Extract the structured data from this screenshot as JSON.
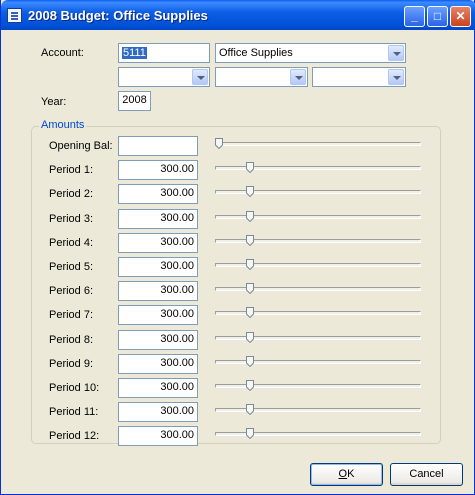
{
  "window": {
    "title": "2008 Budget: Office Supplies",
    "controls": {
      "minimize": "_",
      "maximize": "□",
      "close": "✕"
    }
  },
  "form": {
    "account_label": "Account:",
    "account_code": "5111",
    "account_name": "Office Supplies",
    "segment_1": "",
    "segment_2": "",
    "segment_3": "",
    "year_label": "Year:",
    "year_value": "2008"
  },
  "amounts": {
    "group_title": "Amounts",
    "slider_range": [
      0,
      2000
    ],
    "rows": [
      {
        "label": "Opening Bal:",
        "value": "",
        "slider_value": 0
      },
      {
        "label": "Period 1:",
        "value": "300.00",
        "slider_value": 300
      },
      {
        "label": "Period 2:",
        "value": "300.00",
        "slider_value": 300
      },
      {
        "label": "Period 3:",
        "value": "300.00",
        "slider_value": 300
      },
      {
        "label": "Period 4:",
        "value": "300.00",
        "slider_value": 300
      },
      {
        "label": "Period 5:",
        "value": "300.00",
        "slider_value": 300
      },
      {
        "label": "Period 6:",
        "value": "300.00",
        "slider_value": 300
      },
      {
        "label": "Period 7:",
        "value": "300.00",
        "slider_value": 300
      },
      {
        "label": "Period 8:",
        "value": "300.00",
        "slider_value": 300
      },
      {
        "label": "Period 9:",
        "value": "300.00",
        "slider_value": 300
      },
      {
        "label": "Period 10:",
        "value": "300.00",
        "slider_value": 300
      },
      {
        "label": "Period 11:",
        "value": "300.00",
        "slider_value": 300
      },
      {
        "label": "Period 12:",
        "value": "300.00",
        "slider_value": 300
      }
    ]
  },
  "buttons": {
    "ok_mnemonic": "O",
    "ok_rest": "K",
    "cancel_label": "Cancel"
  },
  "colors": {
    "accent": "#0046D5",
    "titlebar": "#0050D8",
    "selection": "#316AC5"
  }
}
